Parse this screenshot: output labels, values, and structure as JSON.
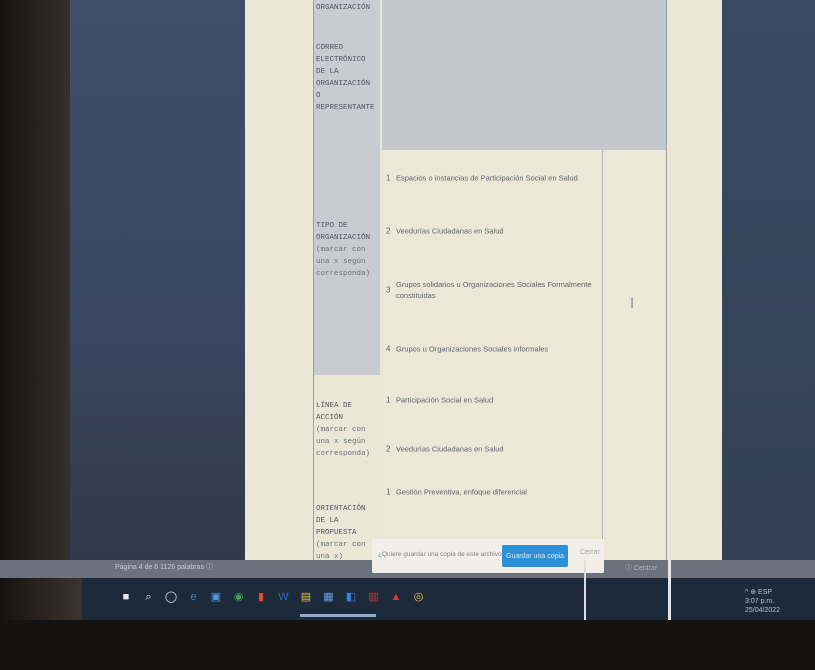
{
  "document": {
    "labels": [
      {
        "title": "ORGANIZACIÓN",
        "sub": ""
      },
      {
        "title": "CORREO ELECTRÓNICO DE LA ORGANIZACIÓN O REPRESENTANTE",
        "sub": ""
      },
      {
        "title": "TIPO DE ORGANIZACIÓN",
        "sub": "(marcar con una x según corresponda)"
      },
      {
        "title": "LÍNEA DE ACCIÓN",
        "sub": "(marcar con una x según corresponda)"
      },
      {
        "title": "ORIENTACIÓN DE LA PROPUESTA",
        "sub": "(marcar con una x)"
      }
    ],
    "rows": [
      {
        "num": "1",
        "text": "Espacios o instancias de Participación Social en Salud"
      },
      {
        "num": "2",
        "text": "Veedurías Ciudadanas en Salud"
      },
      {
        "num": "3",
        "text": "Grupos solidarios u Organizaciones Sociales Formalmente constituidas"
      },
      {
        "num": "4",
        "text": "Grupos u Organizaciones Sociales informales"
      },
      {
        "num": "1",
        "text": "Participación Social en Salud"
      },
      {
        "num": "2",
        "text": "Veedurías Ciudadanas en Salud"
      },
      {
        "num": "1",
        "text": "Gestión Preventiva, enfoque diferencial"
      },
      {
        "num": "",
        "text": ""
      }
    ]
  },
  "statusbar": {
    "left": "Página 4 de 6   1126 palabras   ⓘ",
    "right": "ⓘ Centrar"
  },
  "notice": {
    "text": "¿Quiere guardar una copia de este archivo?",
    "button": "Guardar una copia",
    "close": "Cerrar"
  },
  "taskbar": {
    "icons": [
      "windows-icon",
      "search-icon",
      "task-view-icon",
      "edge-icon",
      "store-icon",
      "chrome-icon",
      "office-icon",
      "word-icon",
      "files-icon",
      "word-doc-icon",
      "app-icon",
      "app2-icon",
      "acrobat-icon",
      "chrome2-icon"
    ],
    "glyphs": [
      "■",
      "⌕",
      "◯",
      "e",
      "▣",
      "◉",
      "▮",
      "W",
      "▤",
      "▦",
      "◧",
      "▥",
      "▲",
      "◎"
    ],
    "colors": [
      "#e6eaf0",
      "#dfe3ea",
      "#dfe3ea",
      "#2f86d4",
      "#4f9de0",
      "#3da55a",
      "#e24e2f",
      "#2b6cc4",
      "#f0c449",
      "#6aa0e0",
      "#3f7fd6",
      "#c03c3c",
      "#d9382e",
      "#f4c242"
    ],
    "tray_time": "3:07 p.m.",
    "tray_date": "25/04/2022",
    "tray_extra": "^ ⊕ ESP"
  }
}
